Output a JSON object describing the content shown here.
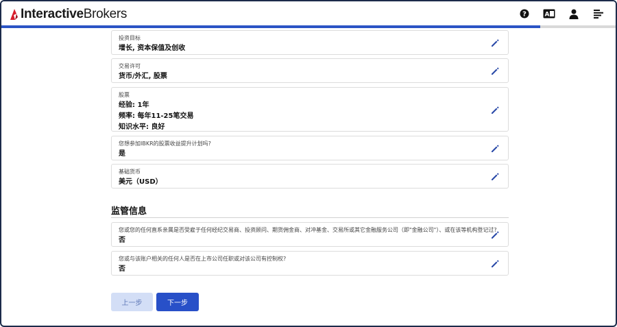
{
  "header": {
    "logo_bold": "Interactive",
    "logo_regular": "Brokers",
    "icons": [
      "help-icon",
      "language-icon",
      "user-icon",
      "menu-icon"
    ],
    "language_icon_glyph": "A"
  },
  "progress": {
    "fraction": 0.877
  },
  "cards": [
    {
      "label": "投资目标",
      "values": [
        "增长, 资本保值及创收"
      ]
    },
    {
      "label": "交易许可",
      "values": [
        "货币/外汇, 股票"
      ]
    },
    {
      "label": "股票",
      "values": [
        "经验: 1年",
        "频率: 每年11-25笔交易",
        "知识水平: 良好"
      ]
    },
    {
      "label": "您想参加IBKR的股票收益提升计划吗?",
      "values": [
        "是"
      ]
    },
    {
      "label": "基础货币",
      "values": [
        "美元（USD）"
      ]
    }
  ],
  "regulatory": {
    "title": "监管信息",
    "cards": [
      {
        "label": "您或您的任何直系亲属是否受雇于任何经纪交易商、投资顾问、期货佣金商、对冲基金、交易所或其它金融服务公司（即\"金融公司\"）、或在该等机构登记过?",
        "values": [
          "否"
        ]
      },
      {
        "label": "您或与该账户相关的任何人是否在上市公司任职或对该公司有控制权?",
        "values": [
          "否"
        ]
      }
    ]
  },
  "buttons": {
    "back": "上一步",
    "next": "下一步"
  },
  "colors": {
    "accent": "#2850c8",
    "logo_red": "#d81e2c"
  }
}
